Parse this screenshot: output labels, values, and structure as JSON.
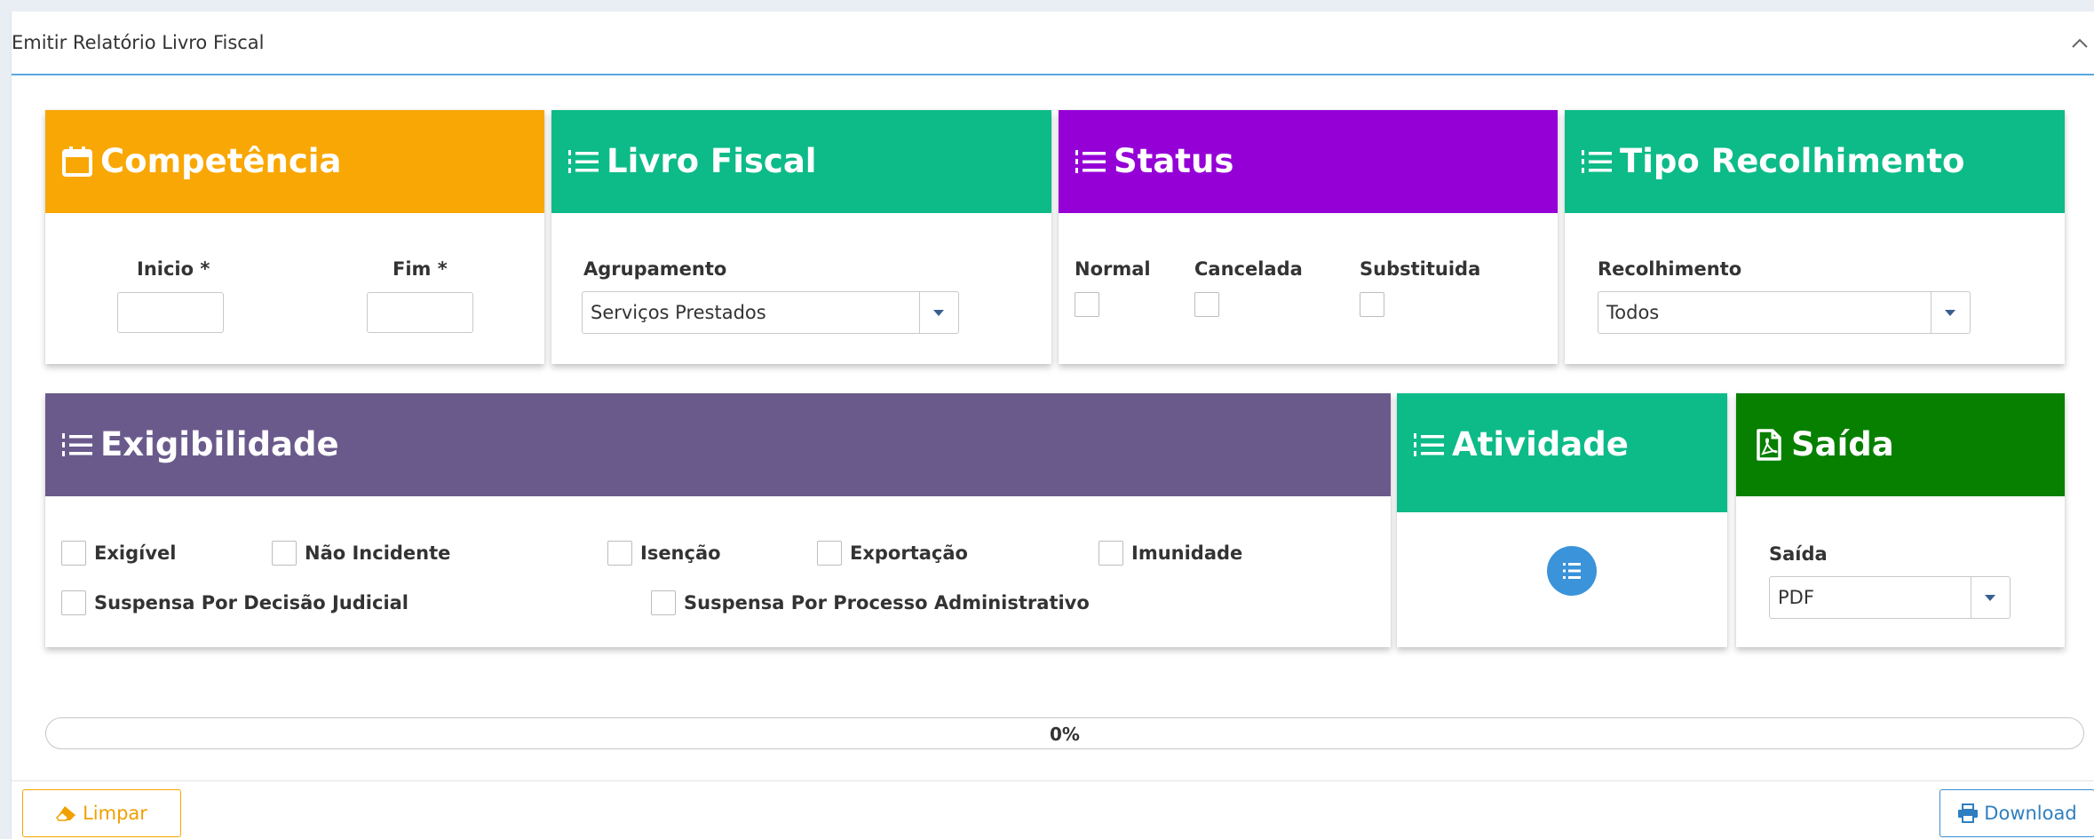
{
  "panel": {
    "title": "Emitir Relatório Livro Fiscal"
  },
  "colors": {
    "competencia": "#f9a704",
    "livro_fiscal": "#0dbb88",
    "status": "#9500d7",
    "tipo_recolhimento": "#0dbb88",
    "exigibilidade": "#6a5a8c",
    "atividade": "#0dbb88",
    "saida": "#078000",
    "accent": "#58a8e0"
  },
  "competencia": {
    "title": "Competência",
    "icon": "calendar-icon",
    "inicio_label": "Inicio *",
    "fim_label": "Fim *",
    "inicio_value": "",
    "fim_value": ""
  },
  "livro_fiscal": {
    "title": "Livro Fiscal",
    "icon": "ordered-list-icon",
    "agrupamento_label": "Agrupamento",
    "agrupamento_value": "Serviços Prestados"
  },
  "status": {
    "title": "Status",
    "icon": "ordered-list-icon",
    "options": [
      "Normal",
      "Cancelada",
      "Substituida"
    ]
  },
  "tipo_recolhimento": {
    "title": "Tipo Recolhimento",
    "icon": "ordered-list-icon",
    "recolhimento_label": "Recolhimento",
    "recolhimento_value": "Todos"
  },
  "exigibilidade": {
    "title": "Exigibilidade",
    "icon": "ordered-list-icon",
    "options": [
      "Exigível",
      "Não Incidente",
      "Isenção",
      "Exportação",
      "Imunidade",
      "Suspensa Por Decisão Judicial",
      "Suspensa Por Processo Administrativo"
    ]
  },
  "atividade": {
    "title": "Atividade",
    "icon": "ordered-list-icon",
    "button_icon": "list-icon"
  },
  "saida": {
    "title": "Saída",
    "icon": "file-pdf-icon",
    "saida_label": "Saída",
    "saida_value": "PDF"
  },
  "progress": {
    "value": 0,
    "label": "0%"
  },
  "footer": {
    "limpar_label": "Limpar",
    "limpar_icon": "eraser-icon",
    "download_label": "Download",
    "download_icon": "print-icon"
  }
}
